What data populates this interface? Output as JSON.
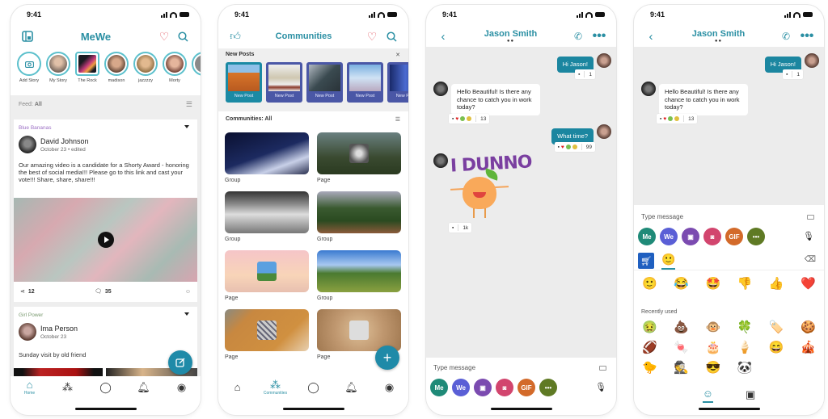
{
  "brand": {
    "teal": "#2a8fa3",
    "bubble_out": "#1b86a0",
    "new_post_active": "#1b8aa4",
    "new_post": "#4a57a6",
    "heart": "#e0545e"
  },
  "status_time": "9:41",
  "phone1": {
    "logo": "MeWe",
    "stories": [
      {
        "label": "Add Story"
      },
      {
        "label": "My Story"
      },
      {
        "label": "The Rock"
      },
      {
        "label": "madison"
      },
      {
        "label": "jazzzzy"
      },
      {
        "label": "Morty"
      }
    ],
    "feed_label": "Feed:",
    "feed_value": "All",
    "post1": {
      "group": "Blue Bananas",
      "group_color": "#9b6fc4",
      "author": "David Johnson",
      "date": "October 23 • edited",
      "text": "Our amazing video is a candidate for a Shorty Award - honoring the best of social media!!! Please go to this link and cast your vote!!! Share, share, share!!!",
      "shares": "12",
      "comments": "35"
    },
    "post2": {
      "group": "Girl Power",
      "group_color": "#7a9a70",
      "author": "Ima Person",
      "date": "October 23",
      "text": "Sunday visit by old friend"
    },
    "tabs": [
      {
        "label": "Home",
        "icon": "home-icon",
        "glyph": "⌂"
      },
      {
        "label": "",
        "icon": "communities-icon",
        "glyph": "⁂"
      },
      {
        "label": "",
        "icon": "chat-icon",
        "glyph": "◯"
      },
      {
        "label": "",
        "icon": "bell-icon",
        "glyph": "🔔︎"
      },
      {
        "label": "",
        "icon": "profile-icon",
        "glyph": "◉"
      }
    ]
  },
  "phone2": {
    "title": "Communities",
    "new_posts_label": "New Posts",
    "new_post_items": [
      "New Post",
      "New Post",
      "New Post",
      "New Post",
      "New Post"
    ],
    "communities_label": "Communities: All",
    "communities": [
      "Group",
      "Page",
      "Group",
      "Group",
      "Page",
      "Group",
      "Page",
      "Page"
    ],
    "tabs": [
      {
        "label": "",
        "icon": "home-icon",
        "glyph": "⌂"
      },
      {
        "label": "Communities",
        "icon": "communities-icon",
        "glyph": "⁂"
      },
      {
        "label": "",
        "icon": "chat-icon",
        "glyph": "◯"
      },
      {
        "label": "",
        "icon": "bell-icon",
        "glyph": "🔔︎"
      },
      {
        "label": "",
        "icon": "profile-icon",
        "glyph": "◉"
      }
    ]
  },
  "chat": {
    "contact": "Jason Smith",
    "messages": [
      {
        "dir": "out",
        "text": "Hi Jason!",
        "reaction_count": "1"
      },
      {
        "dir": "in",
        "text": "Hello Beautiful! Is there any chance to catch you in work today?",
        "reaction_count": "13"
      },
      {
        "dir": "out",
        "text": "What time?",
        "reaction_count": "99"
      }
    ],
    "sticker": {
      "text": "I DUNNO",
      "reaction_count": "1k"
    },
    "composer_placeholder": "Type message",
    "composer_buttons": [
      {
        "label": "Me",
        "color": "#1f8a78",
        "icon": "me-button"
      },
      {
        "label": "We",
        "color": "#5a5fd6",
        "icon": "we-button"
      },
      {
        "label": "▣",
        "color": "#7b4bb0",
        "icon": "photo-icon"
      },
      {
        "label": "◙",
        "color": "#d2456e",
        "icon": "camera-icon"
      },
      {
        "label": "GIF",
        "color": "#d36a2a",
        "icon": "gif-button"
      },
      {
        "label": "•••",
        "color": "#5f7a24",
        "icon": "more-icon"
      }
    ]
  },
  "emoji_panel": {
    "quick_emojis": [
      "🙂",
      "😂",
      "🤩",
      "👎",
      "👍",
      "❤️"
    ],
    "recently_used_label": "Recently used",
    "recent": [
      "🤢",
      "💩",
      "🐵",
      "🍀",
      "🏷️",
      "🍪",
      "🏈",
      "🍬",
      "🎂",
      "🍦",
      "😄",
      "🎪",
      "🐤",
      "🕵️",
      "😎",
      "🐼"
    ]
  }
}
